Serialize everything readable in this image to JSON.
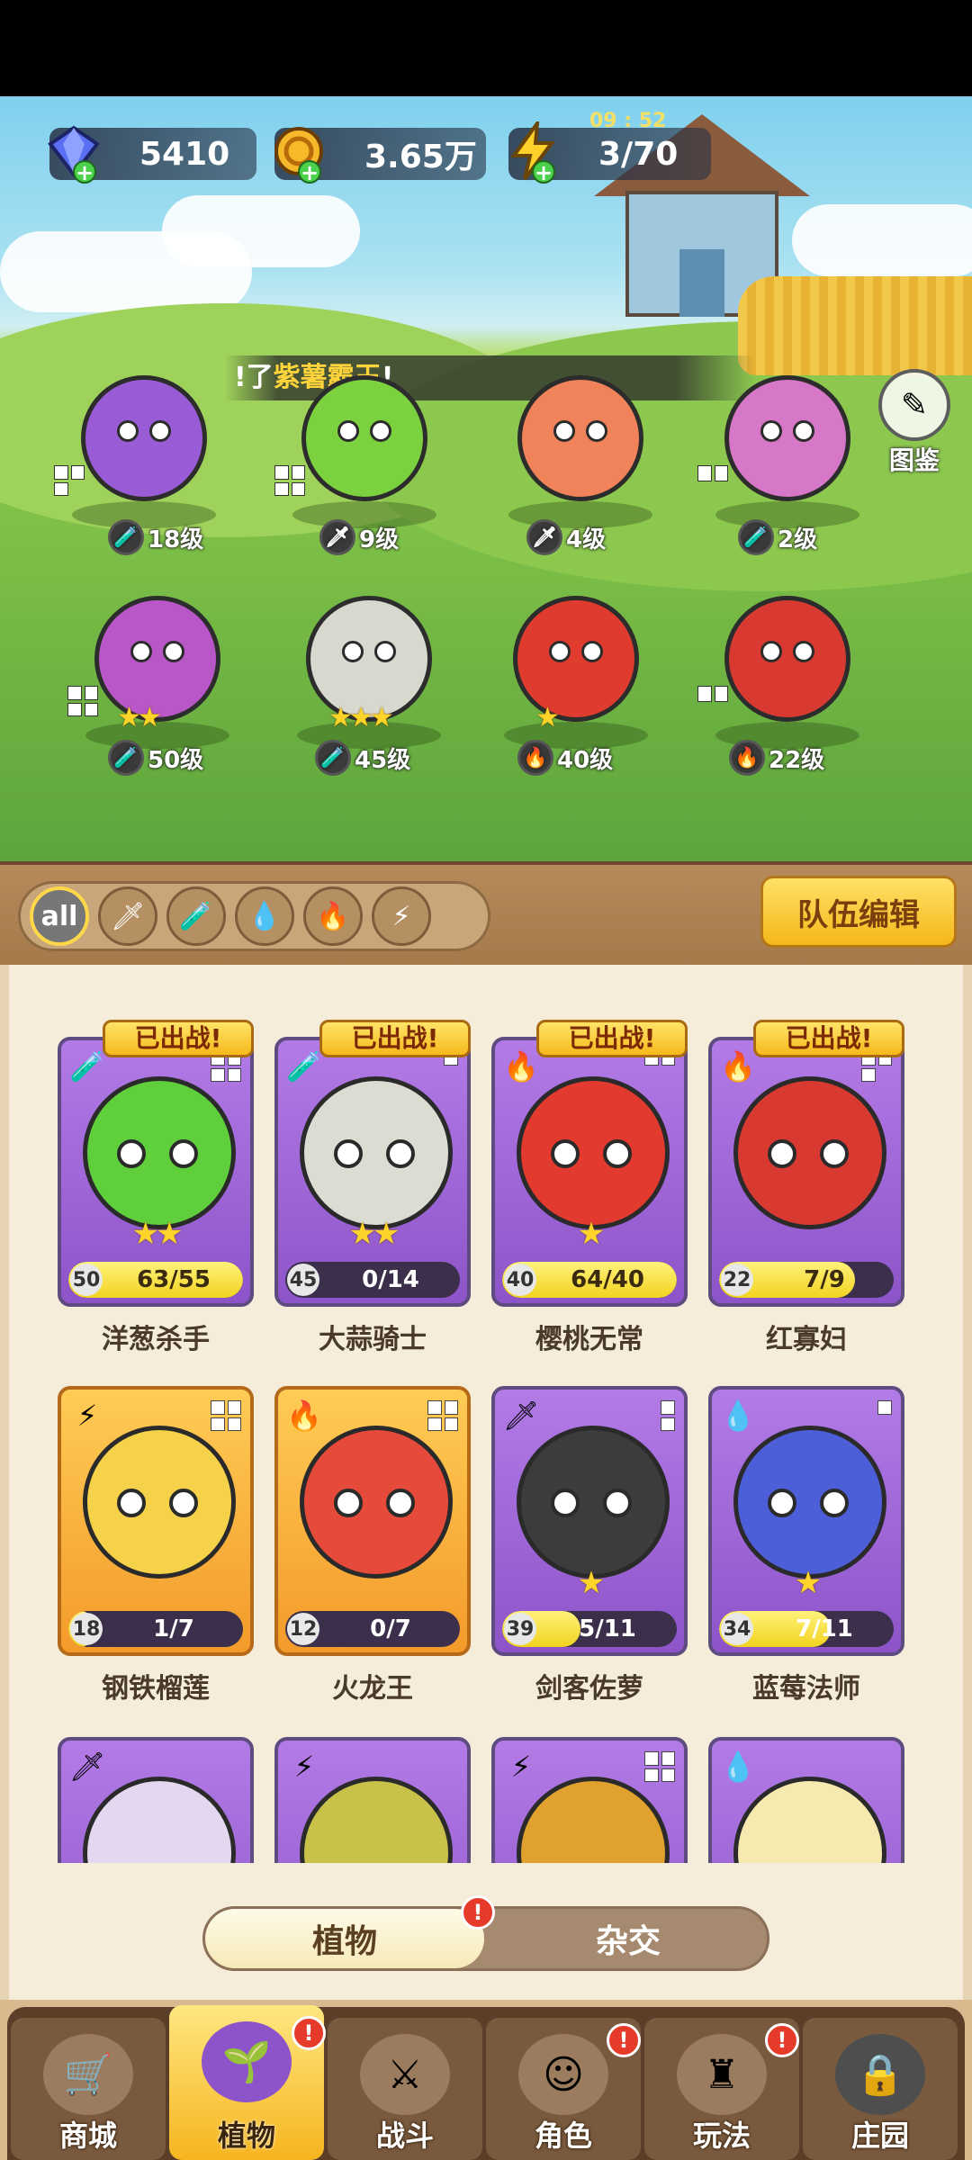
{
  "currency": {
    "gems": "5410",
    "coins": "3.65万",
    "energy": "3/70",
    "energy_timer": "09 : 52"
  },
  "banner": {
    "prefix": "!了",
    "highlight": "紫薯霸王",
    "suffix": "!"
  },
  "album_label": "图鉴",
  "field_plants": [
    {
      "level": "18级",
      "stars": ""
    },
    {
      "level": "9级",
      "stars": ""
    },
    {
      "level": "4级",
      "stars": ""
    },
    {
      "level": "2级",
      "stars": ""
    },
    {
      "level": "50级",
      "stars": "★★"
    },
    {
      "level": "45级",
      "stars": "★★★"
    },
    {
      "level": "40级",
      "stars": "★"
    },
    {
      "level": "22级",
      "stars": ""
    }
  ],
  "filters": {
    "all": "all"
  },
  "team_button": "队伍编辑",
  "deployed_label": "已出战!",
  "cards": [
    {
      "name": "洋葱杀手",
      "level": "50",
      "progress": "63/55",
      "fill": 1.0,
      "stars": "★★"
    },
    {
      "name": "大蒜骑士",
      "level": "45",
      "progress": "0/14",
      "fill": 0.0,
      "stars": "★★"
    },
    {
      "name": "樱桃无常",
      "level": "40",
      "progress": "64/40",
      "fill": 1.0,
      "stars": "★"
    },
    {
      "name": "红寡妇",
      "level": "22",
      "progress": "7/9",
      "fill": 0.78,
      "stars": ""
    },
    {
      "name": "钢铁榴莲",
      "level": "18",
      "progress": "1/7",
      "fill": 0.14,
      "stars": ""
    },
    {
      "name": "火龙王",
      "level": "12",
      "progress": "0/7",
      "fill": 0.0,
      "stars": ""
    },
    {
      "name": "剑客佐萝",
      "level": "39",
      "progress": "5/11",
      "fill": 0.45,
      "stars": "★"
    },
    {
      "name": "蓝莓法师",
      "level": "34",
      "progress": "7/11",
      "fill": 0.64,
      "stars": "★"
    }
  ],
  "toggle": {
    "left": "植物",
    "right": "杂交",
    "alert": "!"
  },
  "nav": [
    {
      "label": "商城",
      "alert": ""
    },
    {
      "label": "植物",
      "alert": "!"
    },
    {
      "label": "战斗",
      "alert": ""
    },
    {
      "label": "角色",
      "alert": "!"
    },
    {
      "label": "玩法",
      "alert": "!"
    },
    {
      "label": "庄园",
      "alert": ""
    }
  ]
}
